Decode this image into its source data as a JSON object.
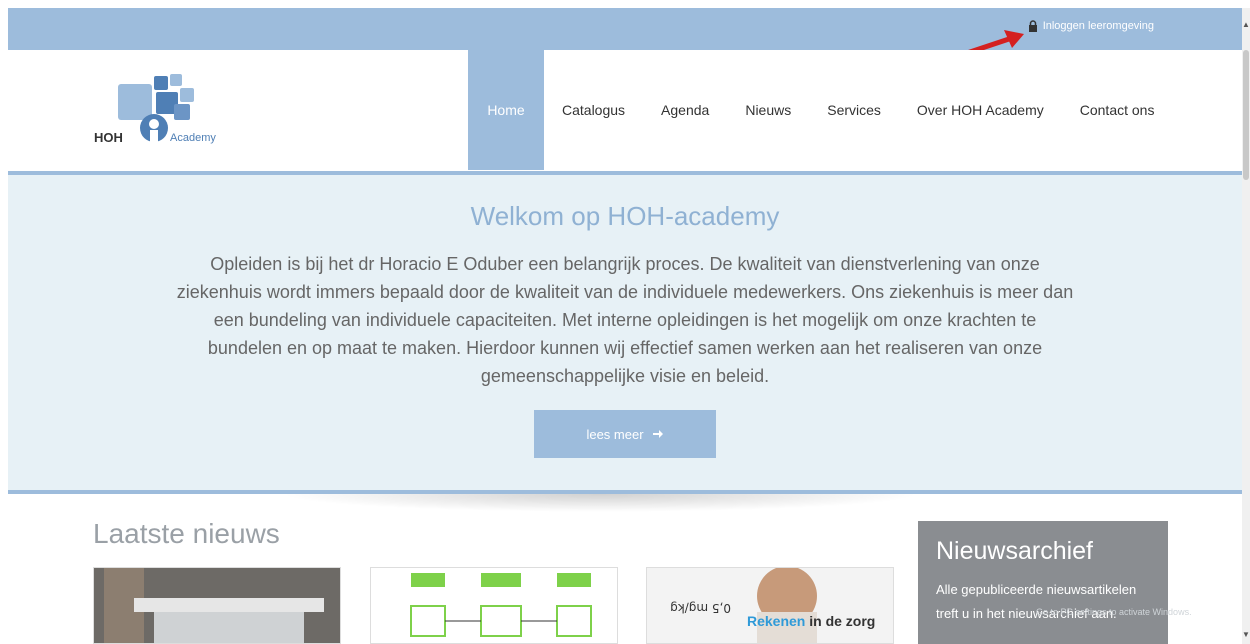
{
  "topbar": {
    "login_label": "Inloggen leeromgeving",
    "lock_icon": "lock-icon"
  },
  "logo": {
    "text_hoh": "HOH",
    "text_academy": "Academy"
  },
  "nav": {
    "items": [
      {
        "label": "Home",
        "active": true
      },
      {
        "label": "Catalogus"
      },
      {
        "label": "Agenda"
      },
      {
        "label": "Nieuws"
      },
      {
        "label": "Services"
      },
      {
        "label": "Over HOH Academy"
      },
      {
        "label": "Contact ons"
      }
    ]
  },
  "hero": {
    "title": "Welkom op HOH-academy",
    "text": "Opleiden is bij het dr Horacio E Oduber een belangrijk proces. De kwaliteit van dienstverlening van onze ziekenhuis wordt immers bepaald door de kwaliteit van de individuele medewerkers. Ons ziekenhuis is meer dan een bundeling van individuele capaciteiten. Met interne opleidingen is het mogelijk om onze krachten te bundelen en op maat te maken. Hierdoor kunnen wij effectief samen werken aan het realiseren van onze gemeenschappelijke visie en beleid.",
    "button_label": "lees meer"
  },
  "news": {
    "title": "Laatste nieuws",
    "card3_text_a": "Rekenen",
    "card3_text_b": " in de zorg"
  },
  "archive": {
    "title": "Nieuwsarchief",
    "text": "Alle gepubliceerde nieuwsartikelen treft u in het nieuwsarchief aan."
  },
  "watermark": "Go to PC settings to activate Windows.",
  "colors": {
    "accent": "#9dbcdc",
    "hero_bg": "#e7f1f6",
    "archive_bg": "#8a8d91",
    "arrow": "#d42020"
  }
}
